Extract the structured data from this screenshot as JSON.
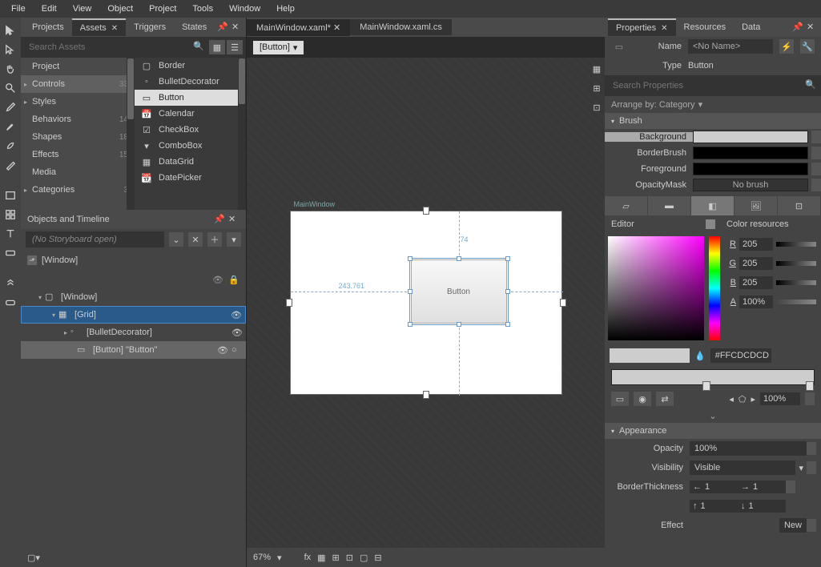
{
  "menu": [
    "File",
    "Edit",
    "View",
    "Object",
    "Project",
    "Tools",
    "Window",
    "Help"
  ],
  "left_tabs": [
    "Projects",
    "Assets",
    "Triggers",
    "States"
  ],
  "assets_search_placeholder": "Search Assets",
  "categories": [
    {
      "name": "Project",
      "count": ""
    },
    {
      "name": "Controls",
      "count": "33",
      "sel": true,
      "exp": true
    },
    {
      "name": "Styles",
      "count": "",
      "exp": true
    },
    {
      "name": "Behaviors",
      "count": "14"
    },
    {
      "name": "Shapes",
      "count": "18"
    },
    {
      "name": "Effects",
      "count": "15"
    },
    {
      "name": "Media",
      "count": ""
    },
    {
      "name": "Categories",
      "count": "3",
      "exp": true
    }
  ],
  "controls": [
    "Border",
    "BulletDecorator",
    "Button",
    "Calendar",
    "CheckBox",
    "ComboBox",
    "DataGrid",
    "DatePicker"
  ],
  "controls_selected": "Button",
  "timeline_title": "Objects and Timeline",
  "storyboard_placeholder": "(No Storyboard open)",
  "window_root": "[Window]",
  "tree": [
    {
      "label": "[Window]",
      "indent": 1,
      "exp": true
    },
    {
      "label": "[Grid]",
      "indent": 2,
      "exp": true,
      "sel": "blue",
      "eye": true
    },
    {
      "label": "[BulletDecorator]",
      "indent": 3,
      "exp": true,
      "eye": true
    },
    {
      "label": "[Button] \"Button\"",
      "indent": 4,
      "sel": "gray",
      "eye": true,
      "lock": true
    }
  ],
  "doc_tabs": [
    "MainWindow.xaml*",
    "MainWindow.xaml.cs"
  ],
  "breadcrumb": "[Button]",
  "artboard_title": "MainWindow",
  "button_text": "Button",
  "guide_x": "243.761",
  "guide_y": "74",
  "zoom": "67%",
  "right_tabs": [
    "Properties",
    "Resources",
    "Data"
  ],
  "name_label": "Name",
  "name_value": "<No Name>",
  "type_label": "Type",
  "type_value": "Button",
  "props_search_placeholder": "Search Properties",
  "arrange_label": "Arrange by: Category",
  "section_brush": "Brush",
  "brushes": [
    {
      "label": "Background",
      "swatch": "bg",
      "sel": true
    },
    {
      "label": "BorderBrush",
      "swatch": ""
    },
    {
      "label": "Foreground",
      "swatch": ""
    },
    {
      "label": "OpacityMask",
      "swatch": "none",
      "text": "No brush"
    }
  ],
  "editor_label": "Editor",
  "colres_label": "Color resources",
  "rgba": {
    "R": "205",
    "G": "205",
    "B": "205",
    "A": "100%"
  },
  "hex": "#FFCDCDCD",
  "offset_value": "100%",
  "section_appearance": "Appearance",
  "opacity_label": "Opacity",
  "opacity_value": "100%",
  "visibility_label": "Visibility",
  "visibility_value": "Visible",
  "thickness_label": "BorderThickness",
  "thickness": [
    "1",
    "1",
    "1",
    "1"
  ],
  "effect_label": "Effect",
  "effect_value": "New"
}
